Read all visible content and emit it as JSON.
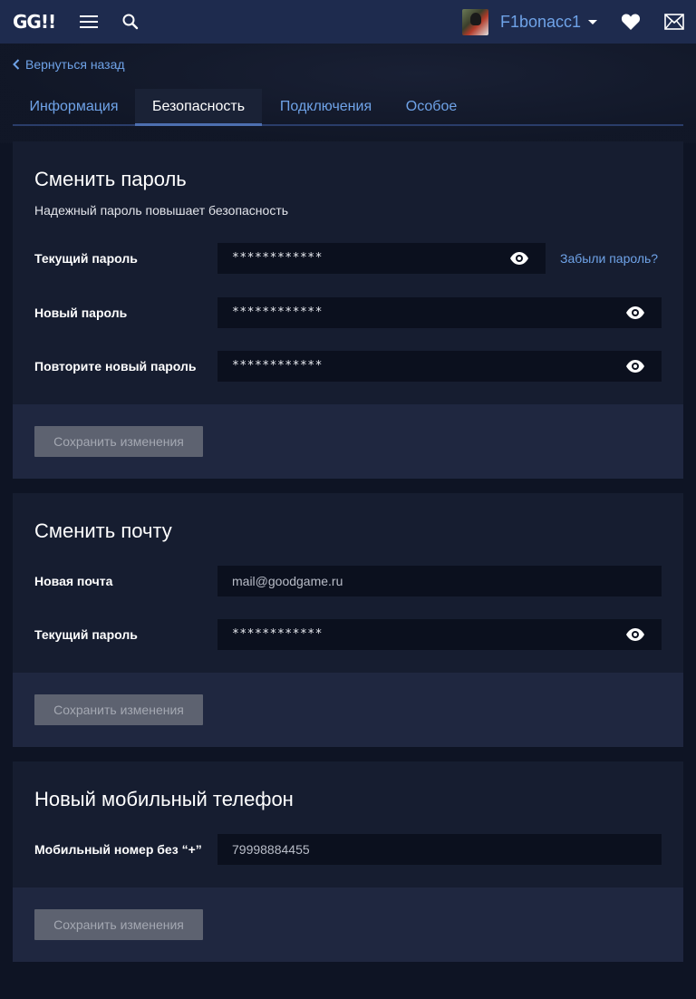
{
  "header": {
    "logo": "GG!!",
    "username": "F1bonacc1"
  },
  "nav": {
    "back_label": "Вернуться назад",
    "tabs": [
      {
        "label": "Информация",
        "active": false
      },
      {
        "label": "Безопасность",
        "active": true
      },
      {
        "label": "Подключения",
        "active": false
      },
      {
        "label": "Особое",
        "active": false
      }
    ]
  },
  "password_card": {
    "title": "Сменить пароль",
    "subtitle": "Надежный пароль повышает безопасность",
    "fields": [
      {
        "label": "Текущий пароль",
        "value": "************"
      },
      {
        "label": "Новый пароль",
        "value": "************"
      },
      {
        "label": "Повторите новый пароль",
        "value": "************"
      }
    ],
    "forgot_label": "Забыли пароль?",
    "save_label": "Сохранить изменения"
  },
  "email_card": {
    "title": "Сменить почту",
    "fields": [
      {
        "label": "Новая почта",
        "value": "mail@goodgame.ru"
      },
      {
        "label": "Текущий пароль",
        "value": "************"
      }
    ],
    "save_label": "Сохранить изменения"
  },
  "phone_card": {
    "title": "Новый мобильный телефон",
    "fields": [
      {
        "label": "Мобильный номер без “+”",
        "value": "79998884455"
      }
    ],
    "save_label": "Сохранить изменения"
  },
  "colors": {
    "header_bg": "#1e2b4e",
    "page_bg": "#0e1424",
    "card_bg": "#161d30",
    "accent_link": "#6fa3e8",
    "button_disabled": "#5d6270"
  },
  "icons": [
    "hamburger-icon",
    "search-icon",
    "caret-down-icon",
    "heart-icon",
    "mail-icon",
    "chevron-left-icon",
    "eye-icon"
  ]
}
